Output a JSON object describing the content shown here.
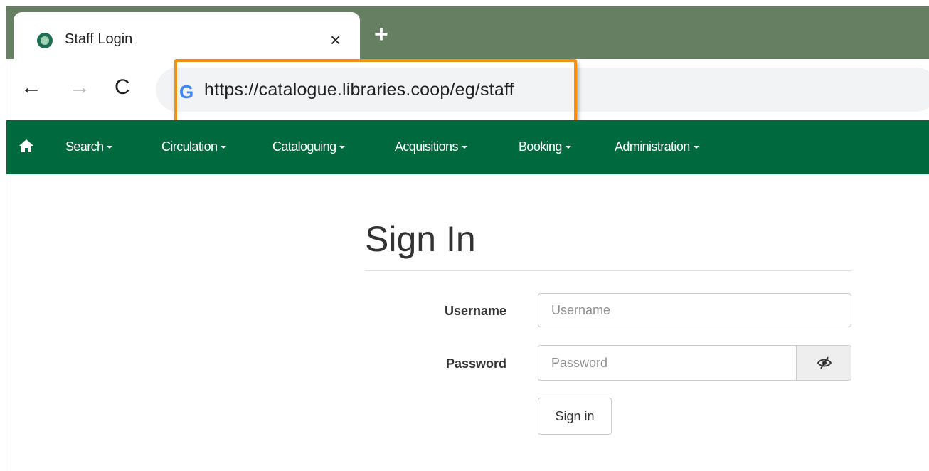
{
  "browser": {
    "tab": {
      "title": "Staff Login",
      "close_glyph": "×",
      "favicon": "evergreen-favicon"
    },
    "new_tab_glyph": "+",
    "nav": {
      "back_glyph": "←",
      "forward_glyph": "→",
      "reload_glyph": "C"
    },
    "omnibox": {
      "search_glyph": "G",
      "url": "https://catalogue.libraries.coop/eg/staff"
    },
    "highlight_color": "#f39019"
  },
  "app_nav": {
    "background": "#00693e",
    "home_icon": "home-icon",
    "items": [
      {
        "label": "Search"
      },
      {
        "label": "Circulation"
      },
      {
        "label": "Cataloguing"
      },
      {
        "label": "Acquisitions"
      },
      {
        "label": "Booking"
      },
      {
        "label": "Administration"
      }
    ]
  },
  "login": {
    "title": "Sign In",
    "username_label": "Username",
    "username_placeholder": "Username",
    "password_label": "Password",
    "password_placeholder": "Password",
    "toggle_icon": "eye-slash-icon",
    "submit_label": "Sign in"
  }
}
